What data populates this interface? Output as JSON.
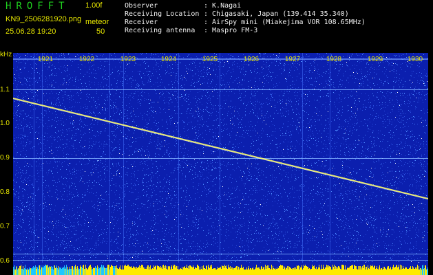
{
  "header": {
    "app_title": "HROFFT",
    "version": "1.00f",
    "filename": "KN9_2506281920.png",
    "meteor_label": "meteor",
    "datetime": "25.06.28 19:20",
    "meteor_count": "50",
    "info": [
      {
        "label": "Observer",
        "value": ": K.Nagai"
      },
      {
        "label": "Receiving Location",
        "value": ": Chigasaki, Japan (139.414 35.340)"
      },
      {
        "label": "Receiver",
        "value": ": AirSpy mini (Miakejima VOR 108.65MHz)"
      },
      {
        "label": "Receiving antenna",
        "value": ": Maspro FM-3"
      }
    ]
  },
  "chart_data": {
    "type": "heatmap",
    "ylabel": "kHz",
    "y_ticks": [
      "1.1",
      "1.0",
      "0.9",
      "0.8",
      "0.7",
      "0.6"
    ],
    "x_ticks": [
      "1921",
      "1922",
      "1923",
      "1924",
      "1925",
      "1926",
      "1927",
      "1928",
      "1929",
      "1930"
    ],
    "colors": {
      "background": "#0b1fae",
      "noise": "#4d8cff",
      "signal": "#ffff66",
      "baseline": "#ffea00",
      "bright": "#ffffff"
    }
  }
}
